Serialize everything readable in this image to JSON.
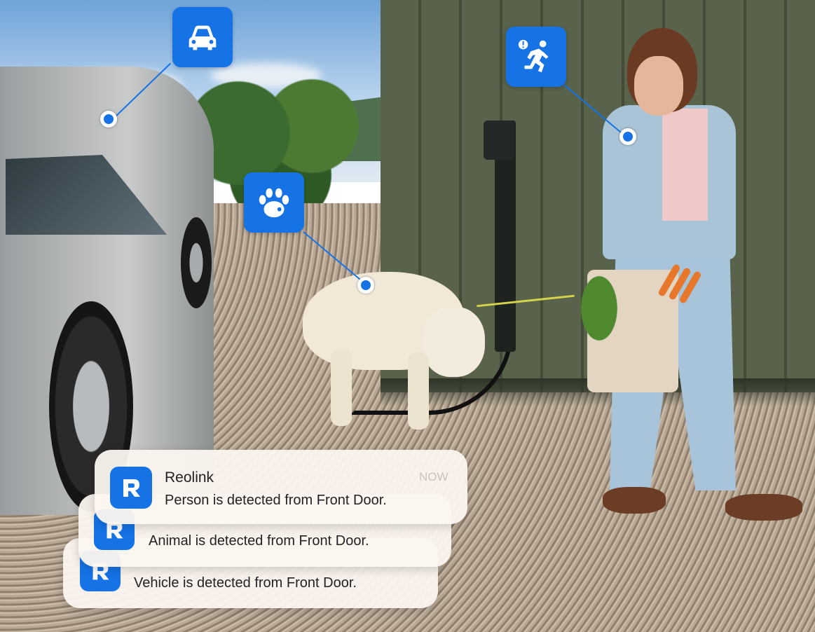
{
  "notifications": [
    {
      "app": "Reolink",
      "message": "Person is detected from Front Door.",
      "time": "NOW"
    },
    {
      "message": "Animal is detected from Front Door."
    },
    {
      "message": "Vehicle is detected from Front Door."
    }
  ],
  "detection_icons": [
    "car-icon",
    "paw-icon",
    "running-person-alert-icon"
  ],
  "colors": {
    "accent": "#1573e6",
    "card": "#fcf5f0"
  }
}
